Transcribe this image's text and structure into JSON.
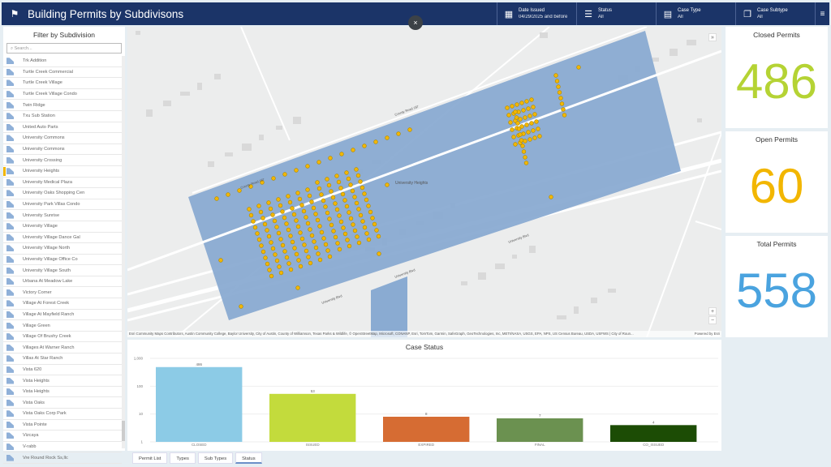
{
  "header": {
    "title": "Building Permits by Subdivisons",
    "logo_icon": "flag-icon",
    "selectors": [
      {
        "label": "Date Issued",
        "value": "04/29/2025 and before",
        "icon": "calendar-icon"
      },
      {
        "label": "Status",
        "value": "All",
        "icon": "list-icon"
      },
      {
        "label": "Case Type",
        "value": "All",
        "icon": "document-icon"
      },
      {
        "label": "Case Subtype",
        "value": "All",
        "icon": "documents-icon"
      }
    ],
    "menu_icon": "hamburger-icon"
  },
  "close_label": "×",
  "filter": {
    "title": "Filter by Subdivision",
    "search_placeholder": "Search...",
    "selected": "University Heights",
    "items": [
      "Trk Addition",
      "Turtle Creek Commercial",
      "Turtle Creek Village",
      "Turtle Creek Village Condo",
      "Twin Ridge",
      "Txu Sub Station",
      "United Auto Parts",
      "University Commons",
      "University Commons",
      "University Crossing",
      "University Heights",
      "University Medical Plaza",
      "University Oaks Shopping Cen",
      "University Park Villas Condo",
      "University Sunrise",
      "University Village",
      "University Village Dance Gal",
      "University Village North",
      "University Village Office Co",
      "University Village South",
      "Urbana At Meadow Lake",
      "Victory Corner",
      "Village At Forest Creek",
      "Village At Mayfield Ranch",
      "Village Green",
      "Village Of Brushy Creek",
      "Villages At Warner Ranch",
      "Villas At Star Ranch",
      "Vista 620",
      "Vista Heights",
      "Vista Heights",
      "Vista Oaks",
      "Vista Oaks Corp Park",
      "Vista Pointe",
      "Vizcaya",
      "V-rabb",
      "Vre Round Rock Ss,llc"
    ]
  },
  "map": {
    "polygon_label": "University Heights",
    "road_labels": [
      "County Road 187",
      "County Road 187",
      "University Blvd",
      "University Blvd",
      "University Blvd"
    ],
    "attribution": "Esri Community Maps Contributors, Austin Community College, Baylor University, City of Austin, County of Williamson, Texas Parks & Wildlife, © OpenStreetMap, Microsoft, CONANP, Esri, TomTom, Garmin, SafeGraph, GeoTechnologies, Inc, METI/NASA, USGS, EPA, NPS, US Census Bureau, USDA, USFWS | City of Roun...",
    "powered_by": "Powered by Esri",
    "zoom_in": "+",
    "zoom_out": "−",
    "expand": "»",
    "colors": {
      "polygon": "#8aabd2",
      "point": "#f2b600"
    }
  },
  "cards": [
    {
      "title": "Closed Permits",
      "value": "486",
      "color": "#b5d334"
    },
    {
      "title": "Open Permits",
      "value": "60",
      "color": "#f2b600"
    },
    {
      "title": "Total Permits",
      "value": "558",
      "color": "#4aa3df"
    }
  ],
  "chart_data": {
    "type": "bar",
    "title": "Case Status",
    "yscale": "log",
    "ylim": [
      1,
      1000
    ],
    "yticks": [
      "1",
      "10",
      "100",
      "1,000"
    ],
    "categories": [
      "CLOSED",
      "ISSUED",
      "EXPIRED",
      "FINAL",
      "CO_ISSUED"
    ],
    "values": [
      486,
      53,
      8,
      7,
      4
    ],
    "colors": [
      "#8ccbe6",
      "#c3db3c",
      "#d66c33",
      "#6b9150",
      "#1c4c05"
    ],
    "grid": true
  },
  "tabs": [
    {
      "label": "Permit List"
    },
    {
      "label": "Types"
    },
    {
      "label": "Sub Types"
    },
    {
      "label": "Status",
      "active": true
    }
  ]
}
